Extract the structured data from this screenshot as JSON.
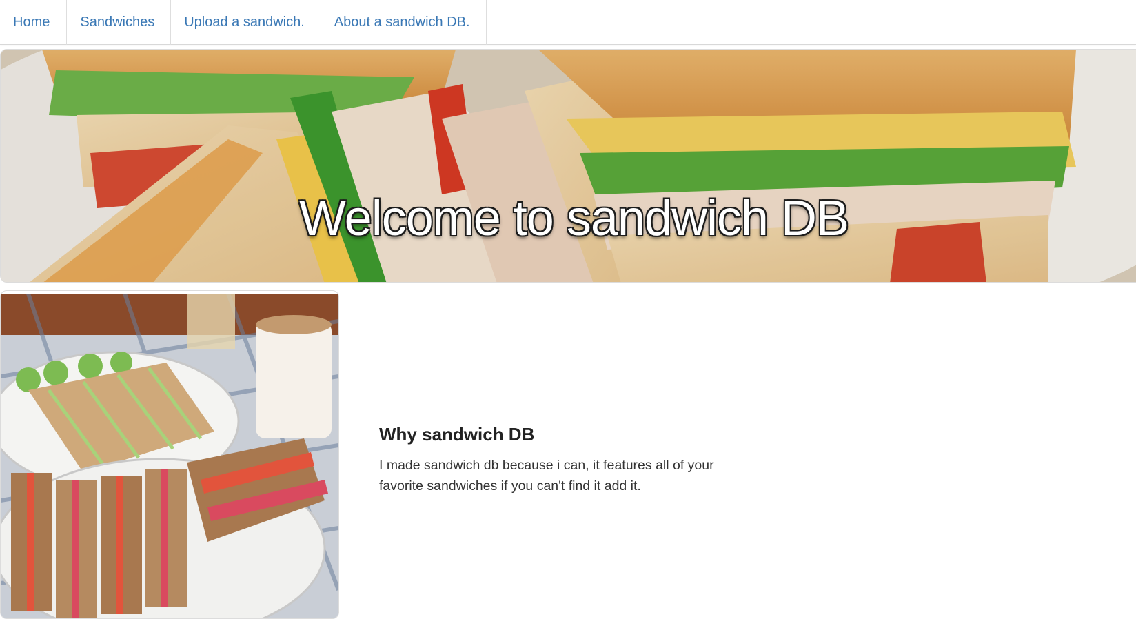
{
  "nav": {
    "items": [
      {
        "label": "Home"
      },
      {
        "label": "Sandwiches"
      },
      {
        "label": "Upload a sandwich."
      },
      {
        "label": "About a sandwich DB."
      }
    ]
  },
  "hero": {
    "title": "Welcome to sandwich DB"
  },
  "about": {
    "heading": "Why sandwich DB",
    "body": "I made sandwich db because i can, it features all of your favorite sandwiches if you can't find it add it."
  },
  "colors": {
    "nav_link": "#3a78b5",
    "border": "#dcdcdc"
  }
}
